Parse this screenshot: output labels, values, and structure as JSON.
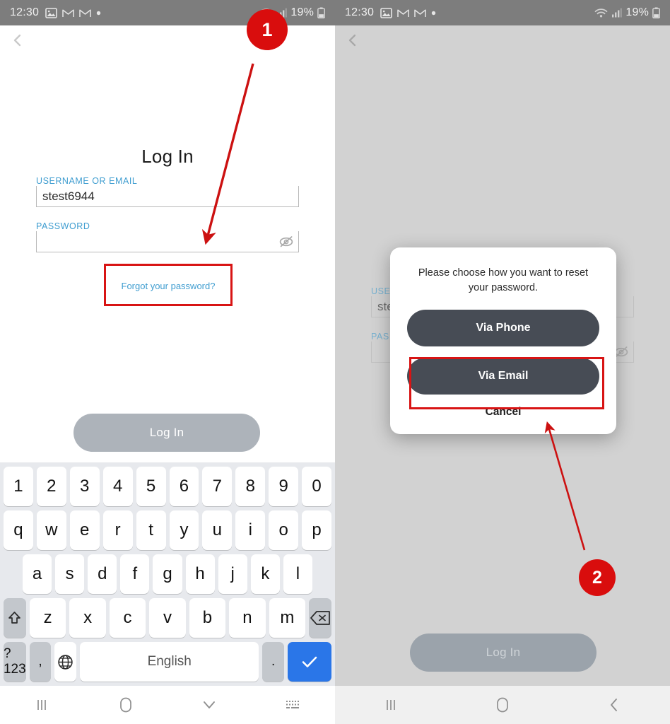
{
  "status_bar": {
    "time": "12:30",
    "icons": [
      "photo-icon",
      "gmail-icon",
      "gmail-icon",
      "dot-icon"
    ],
    "battery_percent": "19%",
    "right_icons": [
      "wifi-icon",
      "signal-icon",
      "battery-icon"
    ]
  },
  "login": {
    "title": "Log In",
    "username_label": "USERNAME OR EMAIL",
    "username_value": "stest6944",
    "username_placeholder": "",
    "password_label": "PASSWORD",
    "password_value": "",
    "password_placeholder": "",
    "forgot_link": "Forgot your password?",
    "submit_label": "Log In",
    "eye_icon": "eye-off-icon"
  },
  "login_right_clipped": {
    "username_label": "USE",
    "username_value": "ste",
    "password_label": "PAS",
    "submit_label": "Log In"
  },
  "dialog": {
    "message": "Please choose how you want to reset your password.",
    "via_phone_label": "Via Phone",
    "via_email_label": "Via Email",
    "cancel_label": "Cancel"
  },
  "keyboard": {
    "row1": [
      "1",
      "2",
      "3",
      "4",
      "5",
      "6",
      "7",
      "8",
      "9",
      "0"
    ],
    "row2": [
      "q",
      "w",
      "e",
      "r",
      "t",
      "y",
      "u",
      "i",
      "o",
      "p"
    ],
    "row3": [
      "a",
      "s",
      "d",
      "f",
      "g",
      "h",
      "j",
      "k",
      "l"
    ],
    "row4_letters": [
      "z",
      "x",
      "c",
      "v",
      "b",
      "n",
      "m"
    ],
    "shift_icon": "shift-icon",
    "backspace_icon": "backspace-icon",
    "symbols_label": "?123",
    "comma_label": ",",
    "globe_icon": "globe-icon",
    "space_label": "English",
    "period_label": ".",
    "enter_icon": "check-icon"
  },
  "nav_bar_left": [
    "recents-icon",
    "home-icon",
    "chevron-down-icon",
    "keyboard-icon"
  ],
  "nav_bar_right": [
    "recents-icon",
    "home-icon",
    "back-icon"
  ],
  "annotations": {
    "badge_1": "1",
    "badge_2": "2",
    "accent_red": "#d90d0d",
    "highlight_color": "#d81414"
  },
  "colors": {
    "status_bar_bg": "#7d7d7d",
    "link_blue": "#3f9dd0",
    "dialog_button": "#474c55",
    "login_button": "#adb3ba",
    "enter_key_blue": "#2a76e8"
  }
}
